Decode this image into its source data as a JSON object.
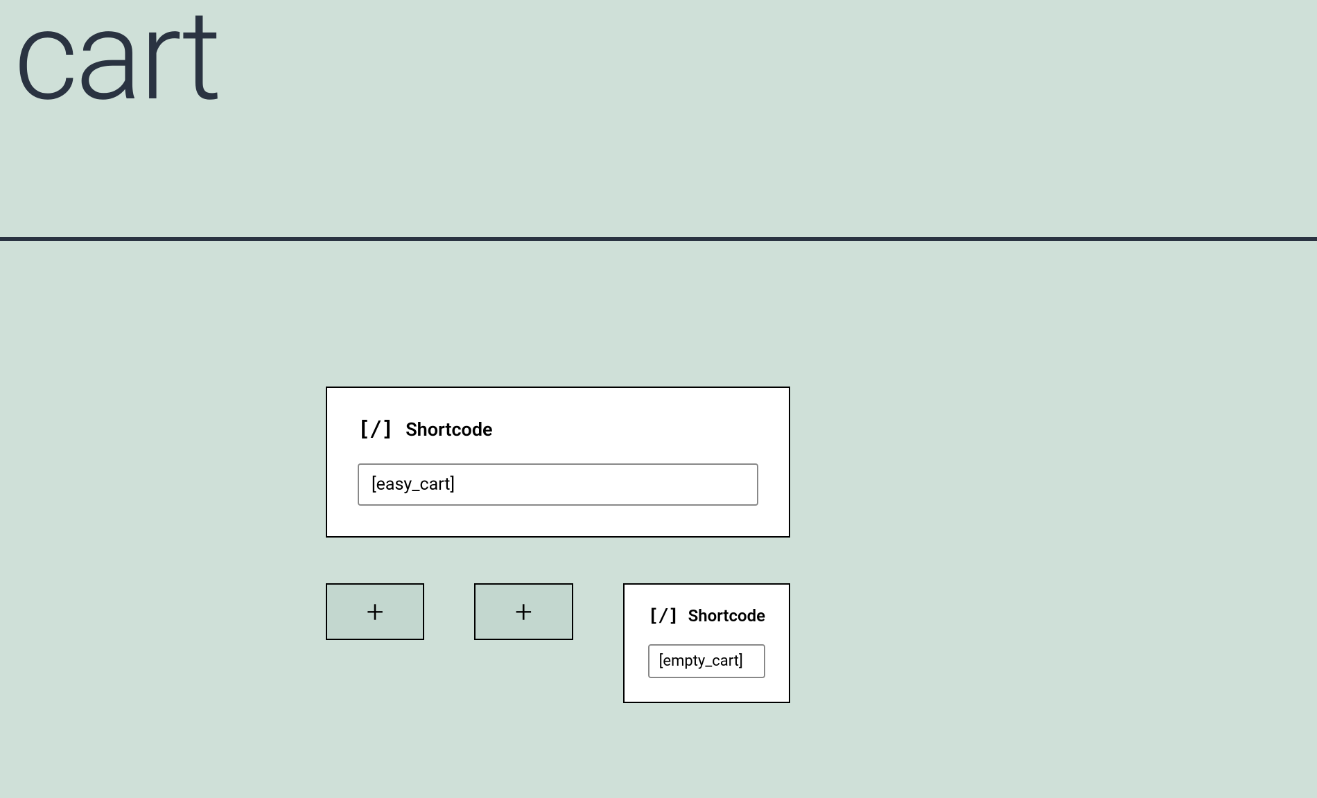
{
  "title": "cart",
  "main_block": {
    "label": "Shortcode",
    "value": "[easy_cart]"
  },
  "columns": {
    "small_block": {
      "label": "Shortcode",
      "value": "[empty_cart]"
    }
  }
}
